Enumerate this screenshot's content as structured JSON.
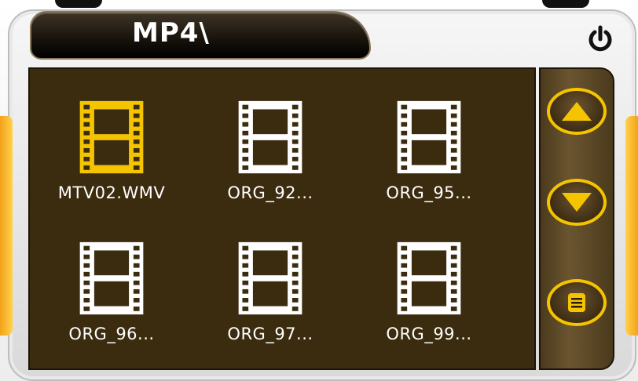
{
  "header": {
    "title": "MP4\\"
  },
  "files": [
    {
      "label": "MTV02.WMV",
      "selected": true
    },
    {
      "label": "ORG_92...",
      "selected": false
    },
    {
      "label": "ORG_95...",
      "selected": false
    },
    {
      "label": "ORG_96...",
      "selected": false
    },
    {
      "label": "ORG_97...",
      "selected": false
    },
    {
      "label": "ORG_99...",
      "selected": false
    }
  ],
  "icons": {
    "power": "power-icon",
    "file": "film-strip-icon",
    "up": "arrow-up-icon",
    "down": "arrow-down-icon",
    "menu": "list-menu-icon"
  },
  "colors": {
    "accent": "#f5c400",
    "panel_bg": "#3b2c0f",
    "file_icon": "#ffffff",
    "file_icon_selected": "#f5c400"
  }
}
